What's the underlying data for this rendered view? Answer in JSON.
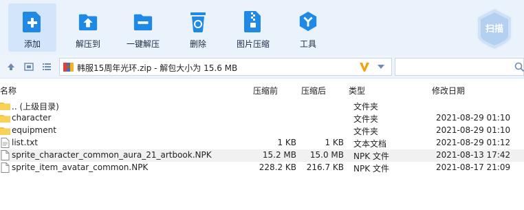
{
  "toolbar": {
    "add": "添加",
    "extract_to": "解压到",
    "one_click_extract": "一键解压",
    "delete": "删除",
    "image_compress": "图片压缩",
    "tools": "工具",
    "scan": "扫描"
  },
  "address": {
    "path": "韩服15周年光环.zip - 解包大小为 15.6 MB",
    "search_placeholder": ""
  },
  "columns": {
    "name": "名称",
    "size": "压缩前",
    "compressed": "压缩后",
    "type": "类型",
    "modified": "修改日期"
  },
  "files": [
    {
      "name": ".. (上级目录)",
      "size": "",
      "compressed": "",
      "type": "文件夹",
      "modified": "",
      "icon": "folder-icon"
    },
    {
      "name": "character",
      "size": "",
      "compressed": "",
      "type": "文件夹",
      "modified": "2021-08-29 01:10",
      "icon": "folder-icon"
    },
    {
      "name": "equipment",
      "size": "",
      "compressed": "",
      "type": "文件夹",
      "modified": "2021-08-29 01:10",
      "icon": "folder-icon"
    },
    {
      "name": "list.txt",
      "size": "1 KB",
      "compressed": "1 KB",
      "type": "文本文档",
      "modified": "2021-08-29 01:12",
      "icon": "text-file-icon"
    },
    {
      "name": "sprite_character_common_aura_21_artbook.NPK",
      "size": "15.2 MB",
      "compressed": "15.0 MB",
      "type": "NPK 文件",
      "modified": "2021-08-13 17:42",
      "icon": "file-icon"
    },
    {
      "name": "sprite_item_avatar_common.NPK",
      "size": "228.2 KB",
      "compressed": "216.7 KB",
      "type": "NPK 文件",
      "modified": "2021-08-17 21:09",
      "icon": "file-icon"
    }
  ],
  "colors": {
    "toolbar_bg": "#eaf2fc",
    "icon_blue": "#1f8ae6",
    "selected_row": "#f1f1f1",
    "folder_yellow": "#f4c23a",
    "accent_orange": "#f5a10b"
  }
}
